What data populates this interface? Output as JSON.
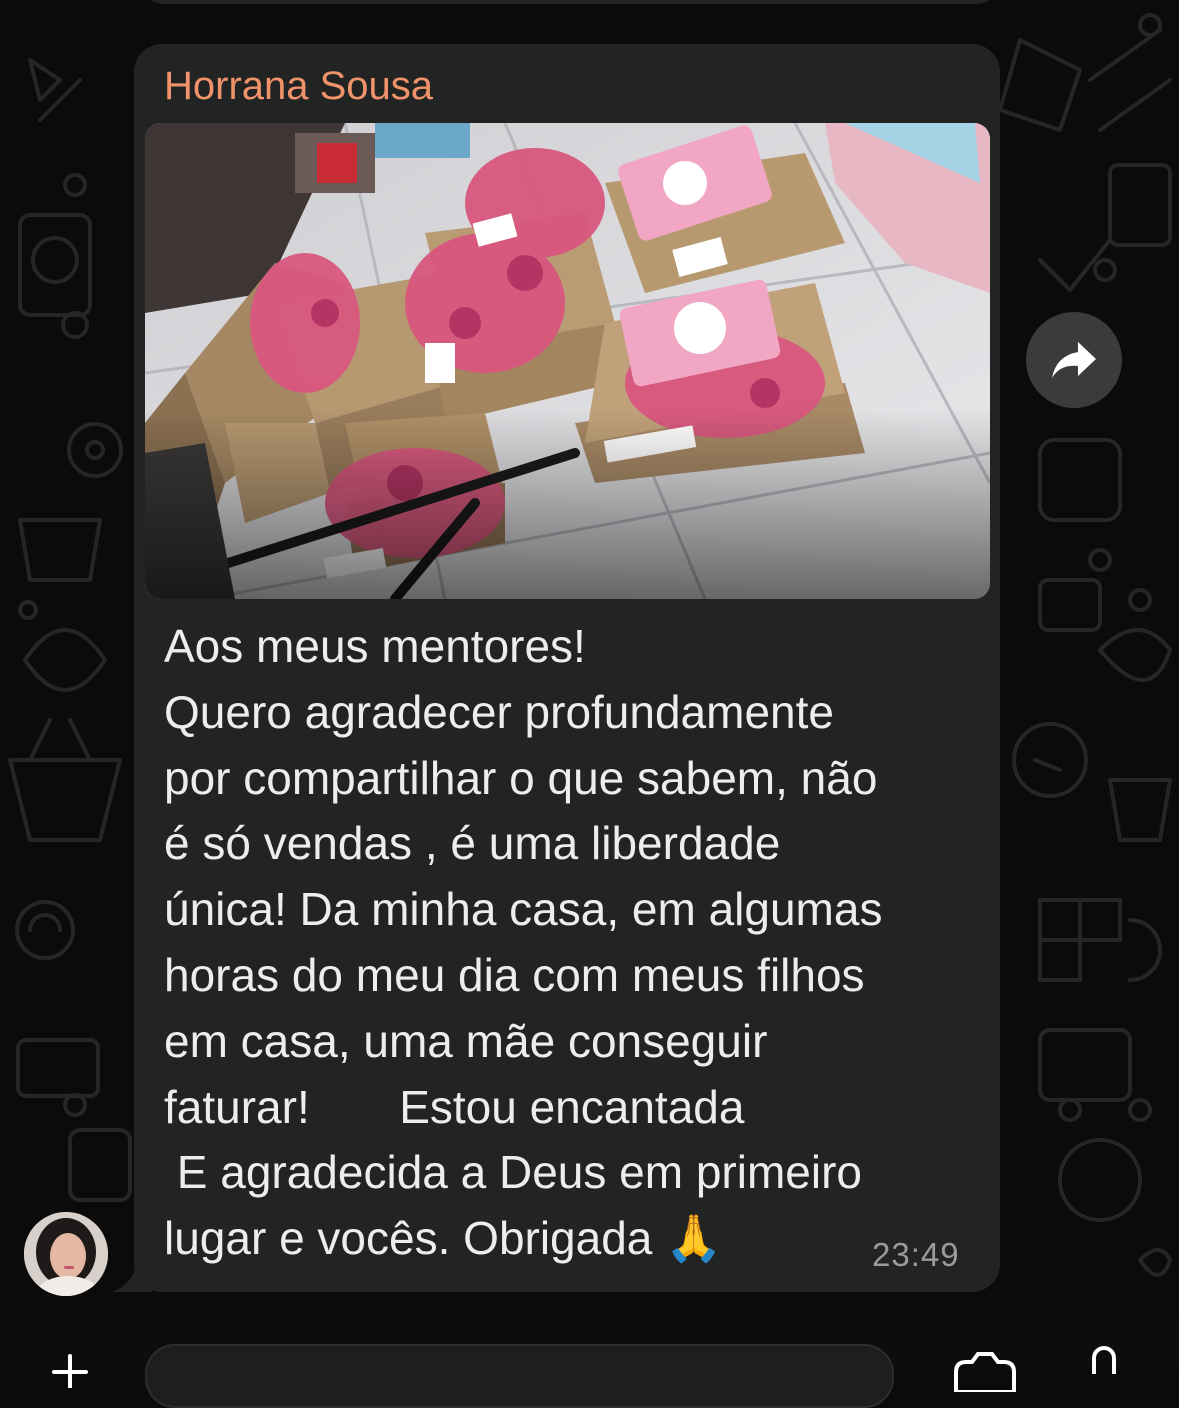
{
  "message": {
    "sender_name": "Horrana Sousa",
    "lines": [
      "Aos meus mentores!",
      "Quero agradecer profundamente",
      "por compartilhar o que sabem, não",
      "é só vendas , é uma liberdade",
      "única! Da minha casa, em algumas",
      "horas do meu dia com meus filhos",
      "em casa, uma mãe conseguir",
      "faturar!       Estou encantada",
      " E agradecida a Deus em primeiro",
      "lugar e vocês. Obrigada 🙏"
    ],
    "time": "23:49"
  },
  "colors": {
    "background": "#0b0b0b",
    "bubble": "#222423",
    "sender_name": "#f0936a",
    "message_text": "#eceeed",
    "timestamp": "#9a9c9b"
  },
  "icons": {
    "forward": "forward-arrow-icon",
    "attach": "plus-icon",
    "camera": "camera-icon",
    "mic": "microphone-icon"
  }
}
